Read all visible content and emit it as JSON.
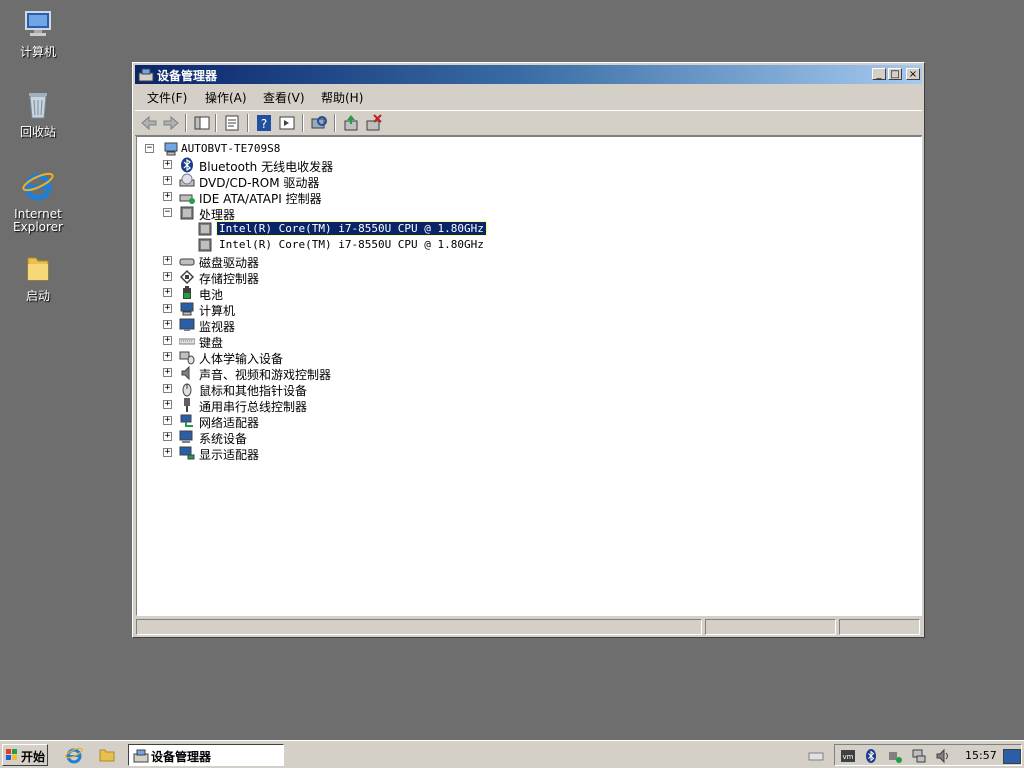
{
  "desktop": {
    "icons": [
      {
        "label": "计算机",
        "icon": "computer-icon"
      },
      {
        "label": "回收站",
        "icon": "recycle-bin-icon"
      },
      {
        "label": "Internet Explorer",
        "icon": "ie-icon"
      },
      {
        "label": "启动",
        "icon": "folder-icon"
      }
    ]
  },
  "window": {
    "title": "设备管理器",
    "menu": [
      "文件(F)",
      "操作(A)",
      "查看(V)",
      "帮助(H)"
    ],
    "toolbar": [
      "back-icon",
      "forward-icon",
      "console-tree-icon",
      "properties-icon",
      "help-icon",
      "export-icon",
      "scan-hardware-icon",
      "update-driver-icon",
      "uninstall-icon"
    ],
    "tree": {
      "root": "AUTOBVT-TE709S8",
      "items": [
        {
          "label": "Bluetooth 无线电收发器",
          "icon": "bluetooth-icon",
          "expanded": false
        },
        {
          "label": "DVD/CD-ROM 驱动器",
          "icon": "dvd-icon",
          "expanded": false
        },
        {
          "label": "IDE ATA/ATAPI 控制器",
          "icon": "ide-icon",
          "expanded": false
        },
        {
          "label": "处理器",
          "icon": "processor-icon",
          "expanded": true,
          "children": [
            {
              "label": "Intel(R) Core(TM) i7-8550U CPU @ 1.80GHz",
              "selected": true
            },
            {
              "label": "Intel(R) Core(TM) i7-8550U CPU @ 1.80GHz",
              "selected": false
            }
          ]
        },
        {
          "label": "磁盘驱动器",
          "icon": "disk-icon",
          "expanded": false
        },
        {
          "label": "存储控制器",
          "icon": "storage-icon",
          "expanded": false
        },
        {
          "label": "电池",
          "icon": "battery-icon",
          "expanded": false
        },
        {
          "label": "计算机",
          "icon": "computer-icon",
          "expanded": false
        },
        {
          "label": "监视器",
          "icon": "monitor-icon",
          "expanded": false
        },
        {
          "label": "键盘",
          "icon": "keyboard-icon",
          "expanded": false
        },
        {
          "label": "人体学输入设备",
          "icon": "hid-icon",
          "expanded": false
        },
        {
          "label": "声音、视频和游戏控制器",
          "icon": "sound-icon",
          "expanded": false
        },
        {
          "label": "鼠标和其他指针设备",
          "icon": "mouse-icon",
          "expanded": false
        },
        {
          "label": "通用串行总线控制器",
          "icon": "usb-icon",
          "expanded": false
        },
        {
          "label": "网络适配器",
          "icon": "network-icon",
          "expanded": false
        },
        {
          "label": "系统设备",
          "icon": "system-icon",
          "expanded": false
        },
        {
          "label": "显示适配器",
          "icon": "display-icon",
          "expanded": false
        }
      ]
    }
  },
  "taskbar": {
    "start_label": "开始",
    "task_label": "设备管理器",
    "clock": "15:57"
  }
}
